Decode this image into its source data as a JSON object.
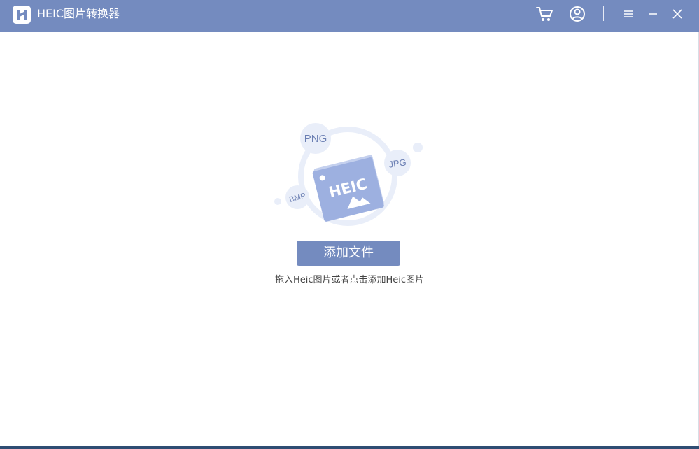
{
  "window": {
    "title": "HEIC图片转换器"
  },
  "titlebar": {
    "icons": {
      "logo": "app-logo-icon",
      "cart": "cart-icon",
      "user": "user-icon",
      "menu": "menu-icon",
      "minimize": "minimize-icon",
      "close": "close-icon"
    }
  },
  "main": {
    "illustration": {
      "center_label": "HEIC",
      "format_labels": [
        "PNG",
        "JPG",
        "BMP"
      ]
    },
    "add_button_label": "添加文件",
    "hint": "拖入Heic图片或者点击添加Heic图片"
  },
  "colors": {
    "accent": "#748bbf",
    "illustration_light": "#e9eef9",
    "illustration_card": "#9db0e0",
    "illustration_text": "#6b7fb3"
  }
}
